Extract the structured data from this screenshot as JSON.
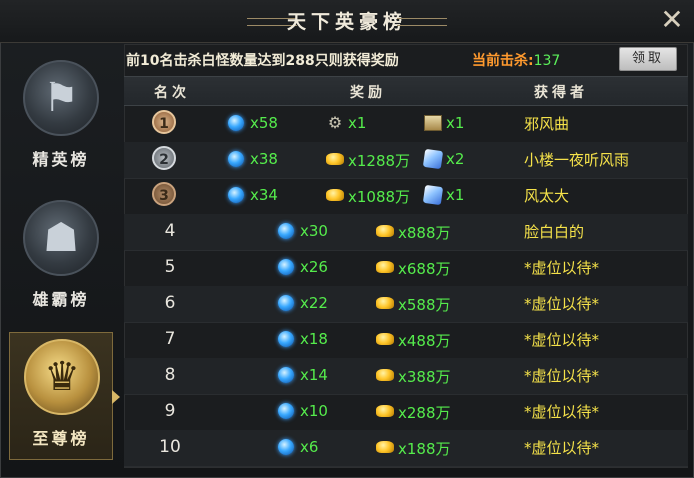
{
  "window": {
    "title": "天下英豪榜",
    "close_icon": "close-x-icon"
  },
  "sidebar": {
    "tabs": [
      {
        "label": "精英榜",
        "icon": "flag-emblem-icon",
        "active": false
      },
      {
        "label": "雄霸榜",
        "icon": "warrior-emblem-icon",
        "active": false
      },
      {
        "label": "至尊榜",
        "icon": "king-emblem-icon",
        "active": true
      }
    ]
  },
  "info": {
    "requirement": "前10名击杀白怪数量达到288只则获得奖励",
    "kills_label": "当前击杀:",
    "kills_value": "137",
    "claim_button": "领取"
  },
  "table": {
    "headers": {
      "rank": "名次",
      "reward": "奖励",
      "winner": "获得者"
    },
    "rows": [
      {
        "rank": "1",
        "medal": true,
        "rewards": [
          {
            "icon": "diamond-icon",
            "qty": "x58"
          },
          {
            "icon": "gear-icon",
            "qty": "x1"
          },
          {
            "icon": "chest-icon",
            "qty": "x1"
          }
        ],
        "winner": "邪风曲"
      },
      {
        "rank": "2",
        "medal": true,
        "rewards": [
          {
            "icon": "diamond-icon",
            "qty": "x38"
          },
          {
            "icon": "gold-icon",
            "qty": "x1288万"
          },
          {
            "icon": "crystal-icon",
            "qty": "x2"
          }
        ],
        "winner": "小楼一夜听风雨"
      },
      {
        "rank": "3",
        "medal": true,
        "rewards": [
          {
            "icon": "diamond-icon",
            "qty": "x34"
          },
          {
            "icon": "gold-icon",
            "qty": "x1088万"
          },
          {
            "icon": "crystal-icon",
            "qty": "x1"
          }
        ],
        "winner": "风太大"
      },
      {
        "rank": "4",
        "medal": false,
        "rewards": [
          {
            "icon": "diamond-icon",
            "qty": "x30"
          },
          {
            "icon": "gold-icon",
            "qty": "x888万"
          }
        ],
        "winner": "脸白白的"
      },
      {
        "rank": "5",
        "medal": false,
        "rewards": [
          {
            "icon": "diamond-icon",
            "qty": "x26"
          },
          {
            "icon": "gold-icon",
            "qty": "x688万"
          }
        ],
        "winner": "*虚位以待*"
      },
      {
        "rank": "6",
        "medal": false,
        "rewards": [
          {
            "icon": "diamond-icon",
            "qty": "x22"
          },
          {
            "icon": "gold-icon",
            "qty": "x588万"
          }
        ],
        "winner": "*虚位以待*"
      },
      {
        "rank": "7",
        "medal": false,
        "rewards": [
          {
            "icon": "diamond-icon",
            "qty": "x18"
          },
          {
            "icon": "gold-icon",
            "qty": "x488万"
          }
        ],
        "winner": "*虚位以待*"
      },
      {
        "rank": "8",
        "medal": false,
        "rewards": [
          {
            "icon": "diamond-icon",
            "qty": "x14"
          },
          {
            "icon": "gold-icon",
            "qty": "x388万"
          }
        ],
        "winner": "*虚位以待*"
      },
      {
        "rank": "9",
        "medal": false,
        "rewards": [
          {
            "icon": "diamond-icon",
            "qty": "x10"
          },
          {
            "icon": "gold-icon",
            "qty": "x288万"
          }
        ],
        "winner": "*虚位以待*"
      },
      {
        "rank": "10",
        "medal": false,
        "rewards": [
          {
            "icon": "diamond-icon",
            "qty": "x6"
          },
          {
            "icon": "gold-icon",
            "qty": "x188万"
          }
        ],
        "winner": "*虚位以待*"
      }
    ]
  },
  "colors": {
    "quantity": "#55ec4c",
    "winner": "#f5e24a",
    "kills_label": "#ff9a2e"
  }
}
